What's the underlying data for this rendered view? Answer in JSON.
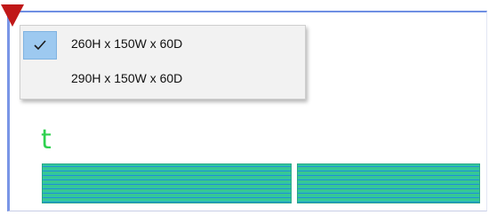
{
  "dropdown": {
    "items": [
      {
        "label": "260H x 150W x 60D",
        "checked": true
      },
      {
        "label": "290H x 150W x 60D",
        "checked": false
      }
    ]
  },
  "canvas": {
    "label": "t",
    "label_color": "#2fd14f",
    "marker_color": "#c01818"
  }
}
